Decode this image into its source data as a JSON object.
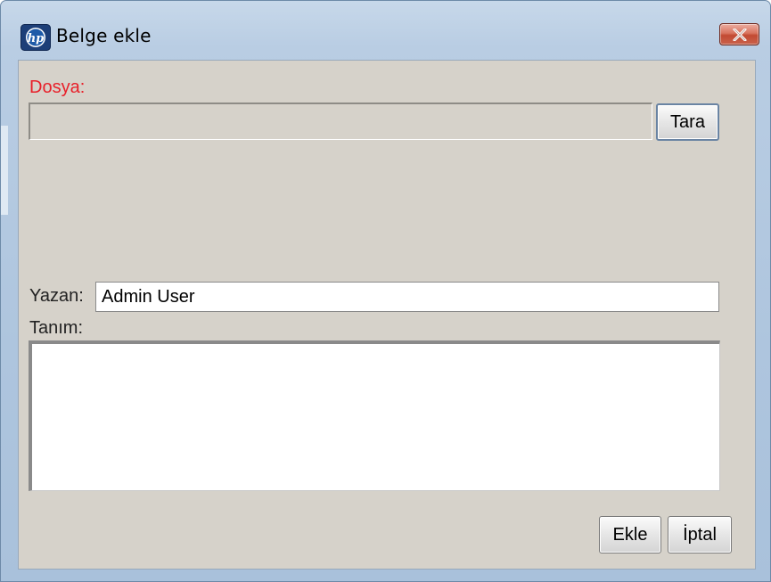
{
  "window": {
    "title": "Belge ekle",
    "icon": "hp-logo-icon",
    "close_icon": "close-icon"
  },
  "form": {
    "file_label": "Dosya:",
    "file_value": "",
    "browse_label": "Tara",
    "author_label": "Yazan:",
    "author_value": "Admin User",
    "description_label": "Tanım:",
    "description_value": ""
  },
  "actions": {
    "add_label": "Ekle",
    "cancel_label": "İptal"
  },
  "colors": {
    "required_label": "#e8202a",
    "dialog_background": "#d6d2ca",
    "close_button": "#c9503a"
  }
}
